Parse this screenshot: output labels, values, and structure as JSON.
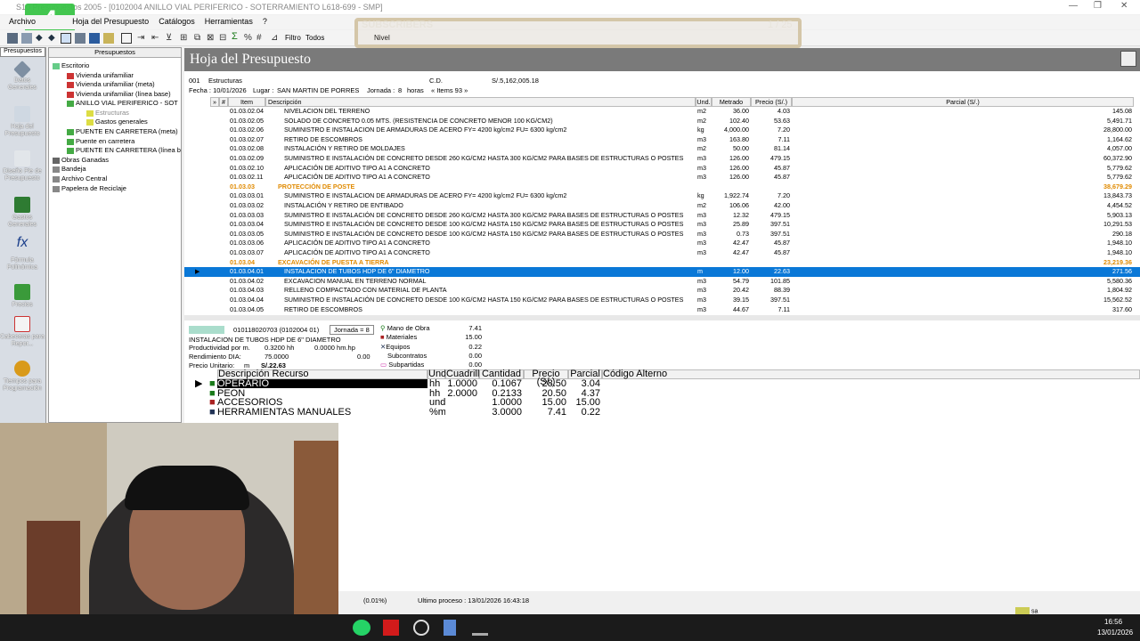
{
  "window": {
    "title": "S10 Presupuestos 2005 - [0102004 ANILLO VIAL PERIFERICO - SOTERRAMIENTO L618-699 - SMP]"
  },
  "menu": [
    "Archivo",
    "Hoja del Presupuesto",
    "Catálogos",
    "Herramientas",
    "?"
  ],
  "toolbar": {
    "filter_label": "Filtro",
    "filter_value": "Todos",
    "level_label": "Nivel"
  },
  "overlay": {
    "label": "SUBSCRIBERS",
    "count": "1 / 25"
  },
  "sidebar": {
    "header": "Presupuestos",
    "items": [
      "Datos Generales",
      "Hoja del Presupuesto",
      "Diseño Pie de Presupuesto",
      "Gastos Generales",
      "Fórmula Polinómica",
      "Precios",
      "Cabeceras para Repor...",
      "Tiempos para Programación"
    ]
  },
  "tree": {
    "header": "Presupuestos",
    "nodes": [
      "Escritorio",
      "Vivienda unifamiliar",
      "Vivienda unifamiliar (meta)",
      "Vivienda unifamiliar (línea base)",
      "ANILLO VIAL PERIFERICO - SOT",
      "Estructuras",
      "Gastos generales",
      "PUENTE EN CARRETERA (meta)",
      "Puente en carretera",
      "PUENTE EN CARRETERA (línea b",
      "Obras Ganadas",
      "Bandeja",
      "Archivo Central",
      "Papelera de Reciclaje"
    ]
  },
  "page": {
    "title": "Hoja del Presupuesto"
  },
  "budget": {
    "code": "001",
    "name": "Estructuras",
    "cd_label": "C.D.",
    "cd_value": "S/.5,162,005.18",
    "fecha_label": "Fecha :",
    "fecha": "10/01/2026",
    "lugar_label": "Lugar :",
    "lugar": "SAN MARTIN DE PORRES",
    "jornada_label": "Jornada :",
    "jornada": "8",
    "horas": "horas",
    "items": "« Items 93 »"
  },
  "columns": {
    "item": "Item",
    "desc": "Descripción",
    "und": "Und.",
    "metrado": "Metrado",
    "precio": "Precio (S/.)",
    "parcial": "Parcial (S/.)"
  },
  "rows": [
    {
      "item": "01.03.02.04",
      "desc": "NIVELACION DEL TERRENO",
      "und": "m2",
      "metrado": "36.00",
      "precio": "4.03",
      "parcial": "145.08"
    },
    {
      "item": "01.03.02.05",
      "desc": "SOLADO DE CONCRETO 0.05 MTS. (RESISTENCIA DE CONCRETO MENOR 100 KG/CM2)",
      "und": "m2",
      "metrado": "102.40",
      "precio": "53.63",
      "parcial": "5,491.71"
    },
    {
      "item": "01.03.02.06",
      "desc": "SUMINISTRO E INSTALACION DE ARMADURAS DE ACERO FY= 4200 kg/cm2 FU= 6300 kg/cm2",
      "und": "kg",
      "metrado": "4,000.00",
      "precio": "7.20",
      "parcial": "28,800.00"
    },
    {
      "item": "01.03.02.07",
      "desc": "RETIRO DE ESCOMBROS",
      "und": "m3",
      "metrado": "163.80",
      "precio": "7.11",
      "parcial": "1,164.62"
    },
    {
      "item": "01.03.02.08",
      "desc": "INSTALACIÓN Y RETIRO DE MOLDAJES",
      "und": "m2",
      "metrado": "50.00",
      "precio": "81.14",
      "parcial": "4,057.00"
    },
    {
      "item": "01.03.02.09",
      "desc": "SUMINISTRO E INSTALACIÓN DE CONCRETO DESDE 260 KG/CM2 HASTA 300 KG/CM2 PARA BASES DE ESTRUCTURAS O POSTES",
      "und": "m3",
      "metrado": "126.00",
      "precio": "479.15",
      "parcial": "60,372.90"
    },
    {
      "item": "01.03.02.10",
      "desc": "APLICACIÓN DE ADITIVO TIPO A1 A CONCRETO",
      "und": "m3",
      "metrado": "126.00",
      "precio": "45.87",
      "parcial": "5,779.62"
    },
    {
      "item": "01.03.02.11",
      "desc": "APLICACIÓN DE ADITIVO TIPO A1 A CONCRETO",
      "und": "m3",
      "metrado": "126.00",
      "precio": "45.87",
      "parcial": "5,779.62"
    },
    {
      "item": "01.03.03",
      "desc": "PROTECCIÓN DE POSTE",
      "und": "",
      "metrado": "",
      "precio": "",
      "parcial": "38,679.29",
      "group": true
    },
    {
      "item": "01.03.03.01",
      "desc": "SUMINISTRO E INSTALACION DE ARMADURAS DE ACERO FY= 4200 kg/cm2 FU= 6300 kg/cm2",
      "und": "kg",
      "metrado": "1,922.74",
      "precio": "7.20",
      "parcial": "13,843.73"
    },
    {
      "item": "01.03.03.02",
      "desc": "INSTALACIÓN Y RETIRO DE ENTIBADO",
      "und": "m2",
      "metrado": "106.06",
      "precio": "42.00",
      "parcial": "4,454.52"
    },
    {
      "item": "01.03.03.03",
      "desc": "SUMINISTRO E INSTALACIÓN DE CONCRETO DESDE 260 KG/CM2 HASTA 300 KG/CM2 PARA BASES DE ESTRUCTURAS O POSTES",
      "und": "m3",
      "metrado": "12.32",
      "precio": "479.15",
      "parcial": "5,903.13"
    },
    {
      "item": "01.03.03.04",
      "desc": "SUMINISTRO E INSTALACIÓN DE CONCRETO DESDE 100 KG/CM2 HASTA 150 KG/CM2 PARA BASES DE ESTRUCTURAS O POSTES",
      "und": "m3",
      "metrado": "25.89",
      "precio": "397.51",
      "parcial": "10,291.53"
    },
    {
      "item": "01.03.03.05",
      "desc": "SUMINISTRO E INSTALACIÓN DE CONCRETO DESDE 100 KG/CM2 HASTA 150 KG/CM2 PARA BASES DE ESTRUCTURAS O POSTES",
      "und": "m3",
      "metrado": "0.73",
      "precio": "397.51",
      "parcial": "290.18"
    },
    {
      "item": "01.03.03.06",
      "desc": "APLICACIÓN DE ADITIVO TIPO A1 A CONCRETO",
      "und": "m3",
      "metrado": "42.47",
      "precio": "45.87",
      "parcial": "1,948.10"
    },
    {
      "item": "01.03.03.07",
      "desc": "APLICACIÓN DE ADITIVO TIPO A1 A CONCRETO",
      "und": "m3",
      "metrado": "42.47",
      "precio": "45.87",
      "parcial": "1,948.10"
    },
    {
      "item": "01.03.04",
      "desc": "EXCAVACIÓN DE PUESTA A TIERRA",
      "und": "",
      "metrado": "",
      "precio": "",
      "parcial": "23,219.36",
      "group": true
    },
    {
      "item": "01.03.04.01",
      "desc": "INSTALACION DE TUBOS HDP DE 6\" DIAMETRO",
      "und": "m",
      "metrado": "12.00",
      "precio": "22.63",
      "parcial": "271.56",
      "selected": true
    },
    {
      "item": "01.03.04.02",
      "desc": "EXCAVACION MANUAL EN TERRENO NORMAL",
      "und": "m3",
      "metrado": "54.79",
      "precio": "101.85",
      "parcial": "5,580.36"
    },
    {
      "item": "01.03.04.03",
      "desc": "RELLENO COMPACTADO CON MATERIAL DE PLANTA",
      "und": "m3",
      "metrado": "20.42",
      "precio": "88.39",
      "parcial": "1,804.92"
    },
    {
      "item": "01.03.04.04",
      "desc": "SUMINISTRO E INSTALACIÓN DE CONCRETO DESDE 100 KG/CM2 HASTA 150 KG/CM2 PARA BASES DE ESTRUCTURAS O POSTES",
      "und": "m3",
      "metrado": "39.15",
      "precio": "397.51",
      "parcial": "15,562.52"
    },
    {
      "item": "01.03.04.05",
      "desc": "RETIRO DE ESCOMBROS",
      "und": "m3",
      "metrado": "44.67",
      "precio": "7.11",
      "parcial": "317.60"
    }
  ],
  "detail": {
    "code": "010118020703 (0102004 01)",
    "jornada": "Jornada = 8",
    "name": "INSTALACION DE TUBOS HDP DE 6\" DIAMETRO",
    "prod_label": "Productividad por m.",
    "prod_hh": "0.3200 hh",
    "prod_hmhp": "0.0000 hm.hp",
    "rend_label": "Rendimiento DIA:",
    "rend_value": "75.0000",
    "rend_extra": "0.00",
    "pu_label": "Precio Unitario:",
    "pu_und": "m",
    "pu_value": "S/.22.63",
    "costs": [
      {
        "label": "Mano de Obra",
        "value": "7.41"
      },
      {
        "label": "Materiales",
        "value": "15.00"
      },
      {
        "label": "Equipos",
        "value": "0.22"
      },
      {
        "label": "Subcontratos",
        "value": "0.00"
      },
      {
        "label": "Subpartidas",
        "value": "0.00"
      }
    ]
  },
  "res_columns": {
    "desc": "Descripción Recurso",
    "und": "Und.",
    "cuad": "Cuadrilla",
    "cant": "Cantidad",
    "precio": "Precio (S/.)",
    "parcial": "Parcial",
    "alt": "Código Alterno"
  },
  "resources": [
    {
      "desc": "OPERARIO",
      "und": "hh",
      "cuad": "1.0000",
      "cant": "0.1067",
      "precio": "28.50",
      "parcial": "3.04"
    },
    {
      "desc": "PEON",
      "und": "hh",
      "cuad": "2.0000",
      "cant": "0.2133",
      "precio": "20.50",
      "parcial": "4.37"
    },
    {
      "desc": "ACCESORIOS",
      "und": "und",
      "cuad": "",
      "cant": "1.0000",
      "precio": "15.00",
      "parcial": "15.00"
    },
    {
      "desc": "HERRAMIENTAS MANUALES",
      "und": "%mo",
      "cuad": "",
      "cant": "3.0000",
      "precio": "7.41",
      "parcial": "0.22"
    }
  ],
  "status": {
    "percent": "(0.01%)",
    "last_process": "Ultimo proceso : 13/01/2026 16:43:18",
    "user": "sa"
  },
  "taskbar": {
    "time": "16:56",
    "date": "13/01/2026"
  }
}
